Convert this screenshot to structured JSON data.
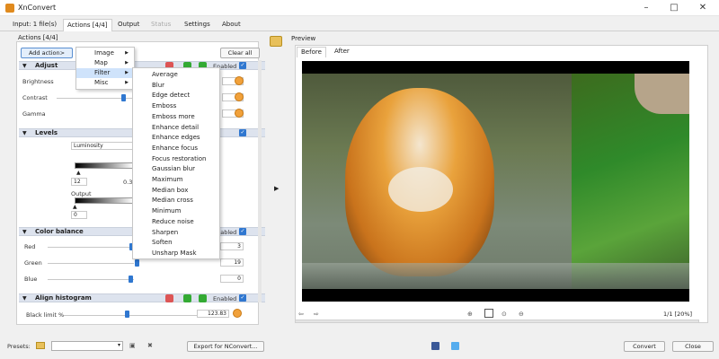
{
  "app": {
    "title": "XnConvert"
  },
  "window": {
    "minimize_glyph": "–",
    "maximize_glyph": "□",
    "close_glyph": "✕"
  },
  "tabs": [
    {
      "label": "Input: 1 file(s)"
    },
    {
      "label": "Actions [4/4]"
    },
    {
      "label": "Output"
    },
    {
      "label": "Status"
    },
    {
      "label": "Settings"
    },
    {
      "label": "About"
    }
  ],
  "left_panel": {
    "group_title": "Actions [4/4]",
    "add_action_label": "Add action>",
    "clear_all_label": "Clear all",
    "enabled_label": "Enabled",
    "check_glyph": "✓",
    "sections": {
      "adjust": {
        "title": "Adjust",
        "params": [
          {
            "label": "Brightness"
          },
          {
            "label": "Contrast"
          },
          {
            "label": "Gamma"
          }
        ]
      },
      "levels": {
        "title": "Levels",
        "channel": "Luminosity",
        "input_min": "12",
        "input_max": "0.3",
        "output_label": "Output",
        "output_value": "0"
      },
      "color_balance": {
        "title": "Color balance",
        "params": [
          {
            "label": "Red",
            "value": "3"
          },
          {
            "label": "Green",
            "value": "19"
          },
          {
            "label": "Blue",
            "value": "0"
          }
        ]
      },
      "align_histogram": {
        "title": "Align histogram",
        "black_limit_label": "Black limit %",
        "black_limit_value": "123.83"
      }
    }
  },
  "add_menu": [
    {
      "label": "Image"
    },
    {
      "label": "Map"
    },
    {
      "label": "Filter"
    },
    {
      "label": "Misc"
    }
  ],
  "filter_menu": [
    "Average",
    "Blur",
    "Edge detect",
    "Emboss",
    "Emboss more",
    "Enhance detail",
    "Enhance edges",
    "Enhance focus",
    "Focus restoration",
    "Gaussian blur",
    "Maximum",
    "Median box",
    "Median cross",
    "Minimum",
    "Reduce noise",
    "Sharpen",
    "Soften",
    "Unsharp Mask"
  ],
  "preview": {
    "title": "Preview",
    "tabs": [
      {
        "label": "Before"
      },
      {
        "label": "After"
      }
    ],
    "page_info": "1/1 [20%]"
  },
  "bottom": {
    "presets_label": "Presets:",
    "export_label": "Export for NConvert...",
    "convert_label": "Convert",
    "close_label": "Close"
  },
  "colors": {
    "accent": "#2f77d0",
    "reset": "#f1a13b",
    "section_bg": "#dde3ee"
  }
}
